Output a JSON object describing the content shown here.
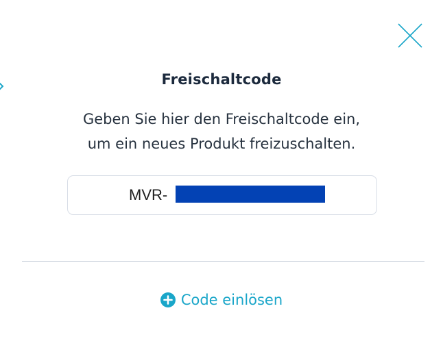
{
  "dialog": {
    "title": "Freischaltcode",
    "description_line1": "Geben Sie hier den Freischaltcode ein,",
    "description_line2": "um ein neues Produkt freizuschalten.",
    "code_input": {
      "value_prefix": "MVR-",
      "redacted": true
    },
    "redeem_button": {
      "label": "Code einlösen",
      "icon": "plus-circle-icon"
    },
    "close_button": {
      "icon": "close-icon"
    }
  },
  "colors": {
    "accent": "#1aa6c9",
    "title": "#1c2a3d",
    "text": "#27323f",
    "redaction": "#0342b4",
    "border": "#d7dde6",
    "divider": "#c3cbd7"
  }
}
